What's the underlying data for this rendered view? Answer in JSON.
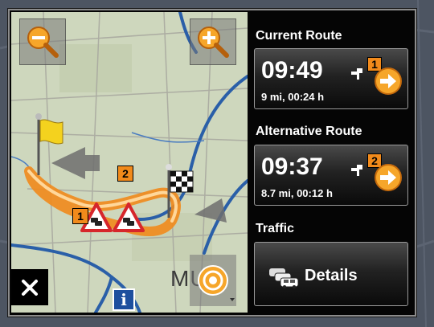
{
  "panel": {
    "current_route": {
      "heading": "Current Route",
      "time": "09:49",
      "summary": "9 mi, 00:24 h",
      "badge": "1",
      "icon": "go-arrow-icon"
    },
    "alternative_route": {
      "heading": "Alternative Route",
      "time": "09:37",
      "summary": "8.7 mi, 00:12 h",
      "badge": "2",
      "icon": "go-arrow-icon"
    },
    "traffic": {
      "heading": "Traffic",
      "details_label": "Details",
      "icon": "traffic-cars-icon"
    }
  },
  "map": {
    "route_badge_1": "1",
    "route_badge_2": "2",
    "city_label": "MU",
    "info_label": "i",
    "zoom_out_icon": "zoom-out-icon",
    "zoom_in_icon": "zoom-in-icon",
    "close_icon": "close-icon",
    "compass_icon": "compass-icon",
    "start_icon": "start-flag-icon",
    "destination_icon": "checkered-flag-icon",
    "warning_icon": "traffic-warning-icon"
  },
  "colors": {
    "route_orange": "#f18a1b",
    "road_blue": "#2a5fa8",
    "map_bg": "#c9d2b7",
    "panel_bg": "#050505"
  }
}
